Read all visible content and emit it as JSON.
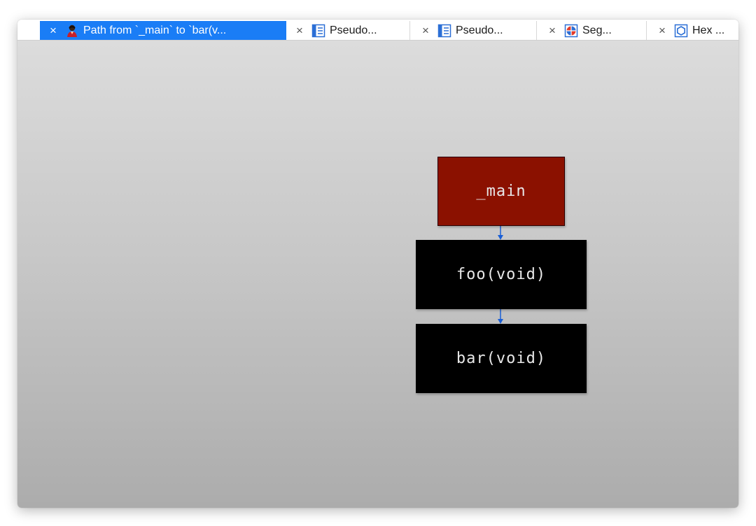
{
  "tabs": [
    {
      "label": "Path from `_main` to `bar(v...",
      "icon": "person-icon",
      "active": true
    },
    {
      "label": "Pseudo...",
      "icon": "pseudocode-icon",
      "active": false
    },
    {
      "label": "Pseudo...",
      "icon": "pseudocode-icon",
      "active": false
    },
    {
      "label": "Seg...",
      "icon": "segments-icon",
      "active": false
    },
    {
      "label": "Hex ...",
      "icon": "hex-view-icon",
      "active": false
    }
  ],
  "close_glyph": "×",
  "graph": {
    "nodes": [
      {
        "id": "_main",
        "label": "_main",
        "color": "#8b1100"
      },
      {
        "id": "foo",
        "label": "foo(void)",
        "color": "#000000"
      },
      {
        "id": "bar",
        "label": "bar(void)",
        "color": "#000000"
      }
    ],
    "edges": [
      {
        "from": "_main",
        "to": "foo"
      },
      {
        "from": "foo",
        "to": "bar"
      }
    ],
    "edge_color": "#1a5fd6"
  },
  "colors": {
    "active_tab": "#1a7df6"
  }
}
